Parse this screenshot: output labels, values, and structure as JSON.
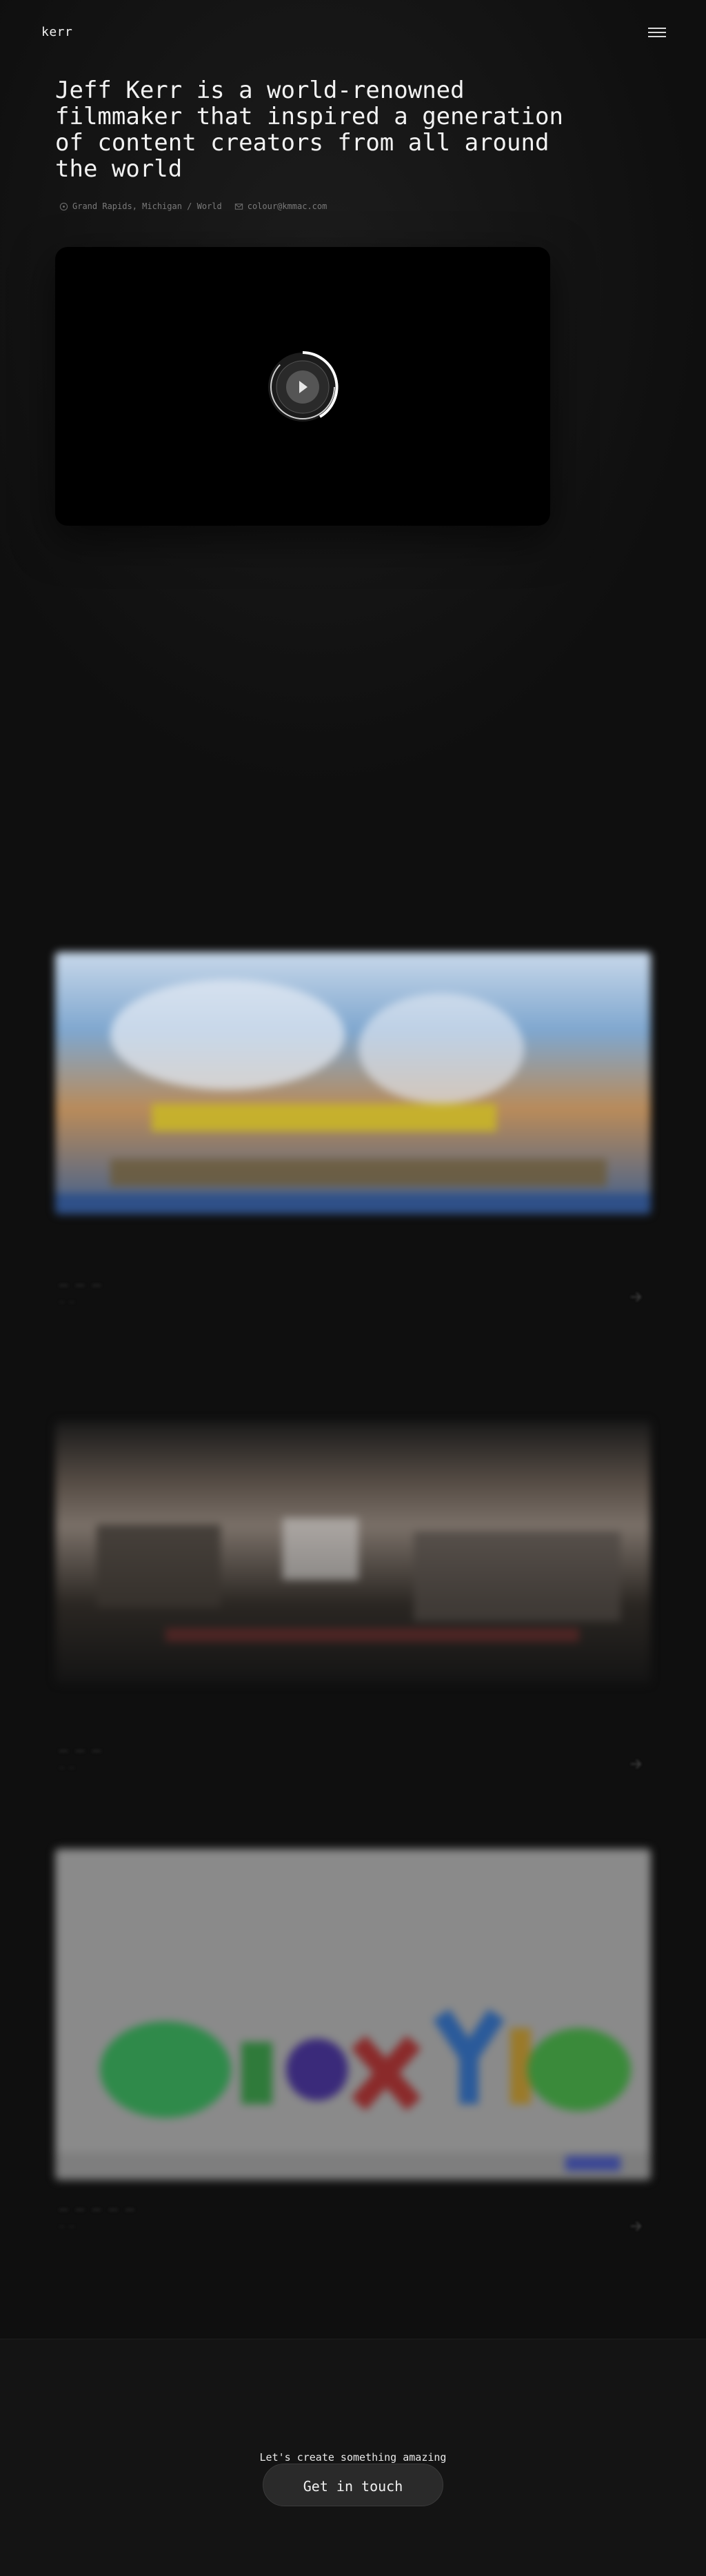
{
  "header": {
    "logo": "kerr",
    "menu_icon": "hamburger-icon"
  },
  "hero": {
    "title": "Jeff Kerr is a world-renowned filmmaker that inspired a generation of content creators from all around the world",
    "location": "Grand Rapids, Michigan / World",
    "email": "colour@kmmac.com",
    "location_icon": "map-pin-icon",
    "email_icon": "mail-icon",
    "video_play_icon": "play-icon"
  },
  "footer": {
    "tagline": "Let's create something amazing",
    "cta_label": "Get in touch"
  },
  "colors": {
    "background": "#0f0f0f",
    "footer": "#141414",
    "button": "#2a2a2a"
  }
}
